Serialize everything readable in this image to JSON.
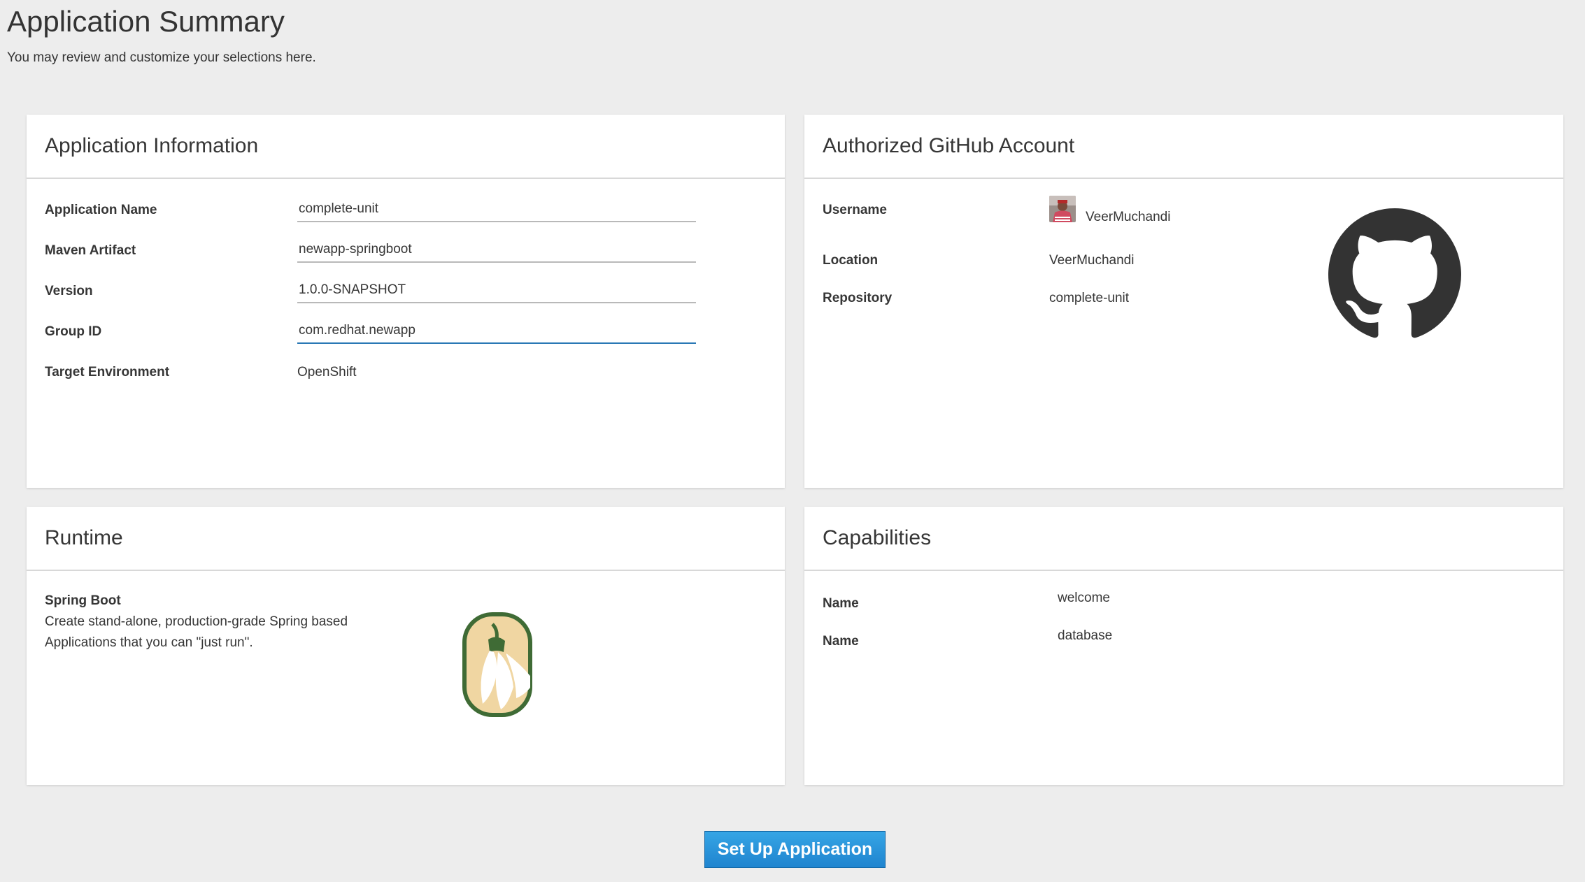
{
  "page": {
    "title": "Application Summary",
    "subtitle": "You may review and customize your selections here."
  },
  "app_info": {
    "header": "Application Information",
    "fields": [
      {
        "label": "Application Name",
        "value": "complete-unit"
      },
      {
        "label": "Maven Artifact",
        "value": "newapp-springboot"
      },
      {
        "label": "Version",
        "value": "1.0.0-SNAPSHOT"
      },
      {
        "label": "Group ID",
        "value": "com.redhat.newapp"
      }
    ],
    "target_label": "Target Environment",
    "target_value": "OpenShift"
  },
  "github": {
    "header": "Authorized GitHub Account",
    "username_label": "Username",
    "username": "VeerMuchandi",
    "location_label": "Location",
    "location": "VeerMuchandi",
    "repository_label": "Repository",
    "repository": "complete-unit",
    "logo_icon": "github-octocat-icon"
  },
  "runtime": {
    "header": "Runtime",
    "name": "Spring Boot",
    "description_line1": "Create stand-alone, production-grade Spring based",
    "description_line2": "Applications that you can \"just run\".",
    "logo_icon": "spring-boot-snowdrop-icon"
  },
  "capabilities": {
    "header": "Capabilities",
    "items": [
      {
        "label": "Name",
        "value": "welcome"
      },
      {
        "label": "Name",
        "value": "database"
      }
    ]
  },
  "actions": {
    "setup_label": "Set Up Application"
  },
  "colors": {
    "background": "#ededed",
    "primary_button": "#1f84cf",
    "focused_underline": "#2a78b5",
    "github_logo": "#333333",
    "spring_logo_bg": "#f0d6a2",
    "spring_logo_border": "#3f6b35"
  }
}
